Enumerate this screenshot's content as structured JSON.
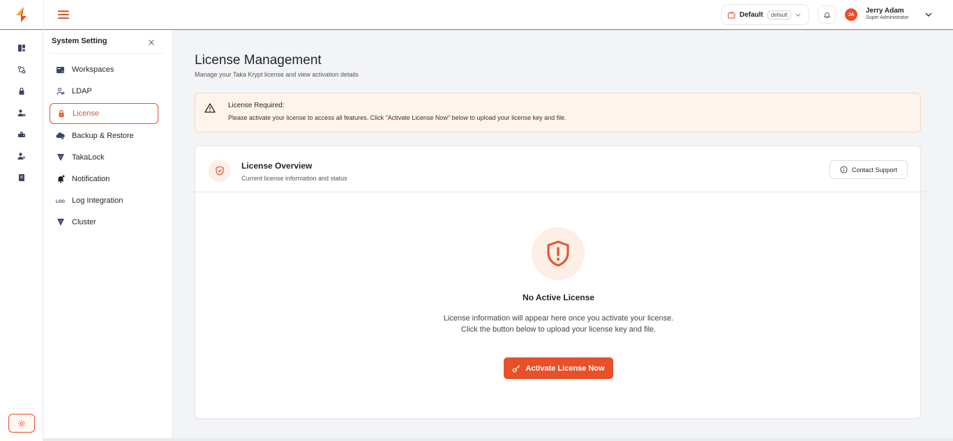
{
  "topbar": {
    "workspace_label": "Default",
    "workspace_tag": "default",
    "user_initials": "JA",
    "user_name": "Jerry Adam",
    "user_role": "Super Administrator"
  },
  "rail": {
    "icons": [
      "dashboard-icon",
      "key-routing-icon",
      "lock-icon",
      "user-lock-icon",
      "hsm-device-icon",
      "user-key-icon",
      "report-icon"
    ],
    "settings_icon": "gear-icon"
  },
  "panel": {
    "title": "System Setting",
    "items": [
      {
        "label": "Workspaces",
        "icon": "workspaces-icon"
      },
      {
        "label": "LDAP",
        "icon": "ldap-user-icon"
      },
      {
        "label": "License",
        "icon": "lock-icon",
        "active": true
      },
      {
        "label": "Backup & Restore",
        "icon": "cloud-backup-icon"
      },
      {
        "label": "TakaLock",
        "icon": "takalock-icon"
      },
      {
        "label": "Notification",
        "icon": "bell-icon"
      },
      {
        "label": "Log Integration",
        "icon": "log-icon"
      },
      {
        "label": "Cluster",
        "icon": "cluster-icon"
      }
    ]
  },
  "main": {
    "title": "License Management",
    "subtitle": "Manage your Taka Krypt license and view activation details",
    "alert": {
      "title": "License Required:",
      "text": "Please activate your license to access all features. Click \"Activate License Now\" below to upload your license key and file."
    },
    "card": {
      "title": "License Overview",
      "subtitle": "Current license information and status",
      "contact_label": "Contact Support",
      "empty_title": "No Active License",
      "empty_line1": "License information will appear here once you activate your license.",
      "empty_line2": "Click the button below to upload your license key and file.",
      "activate_label": "Activate License Now"
    }
  },
  "colors": {
    "accent": "#e8502a",
    "accent_soft": "#fdeee6",
    "alert_bg": "#fef4ec"
  }
}
